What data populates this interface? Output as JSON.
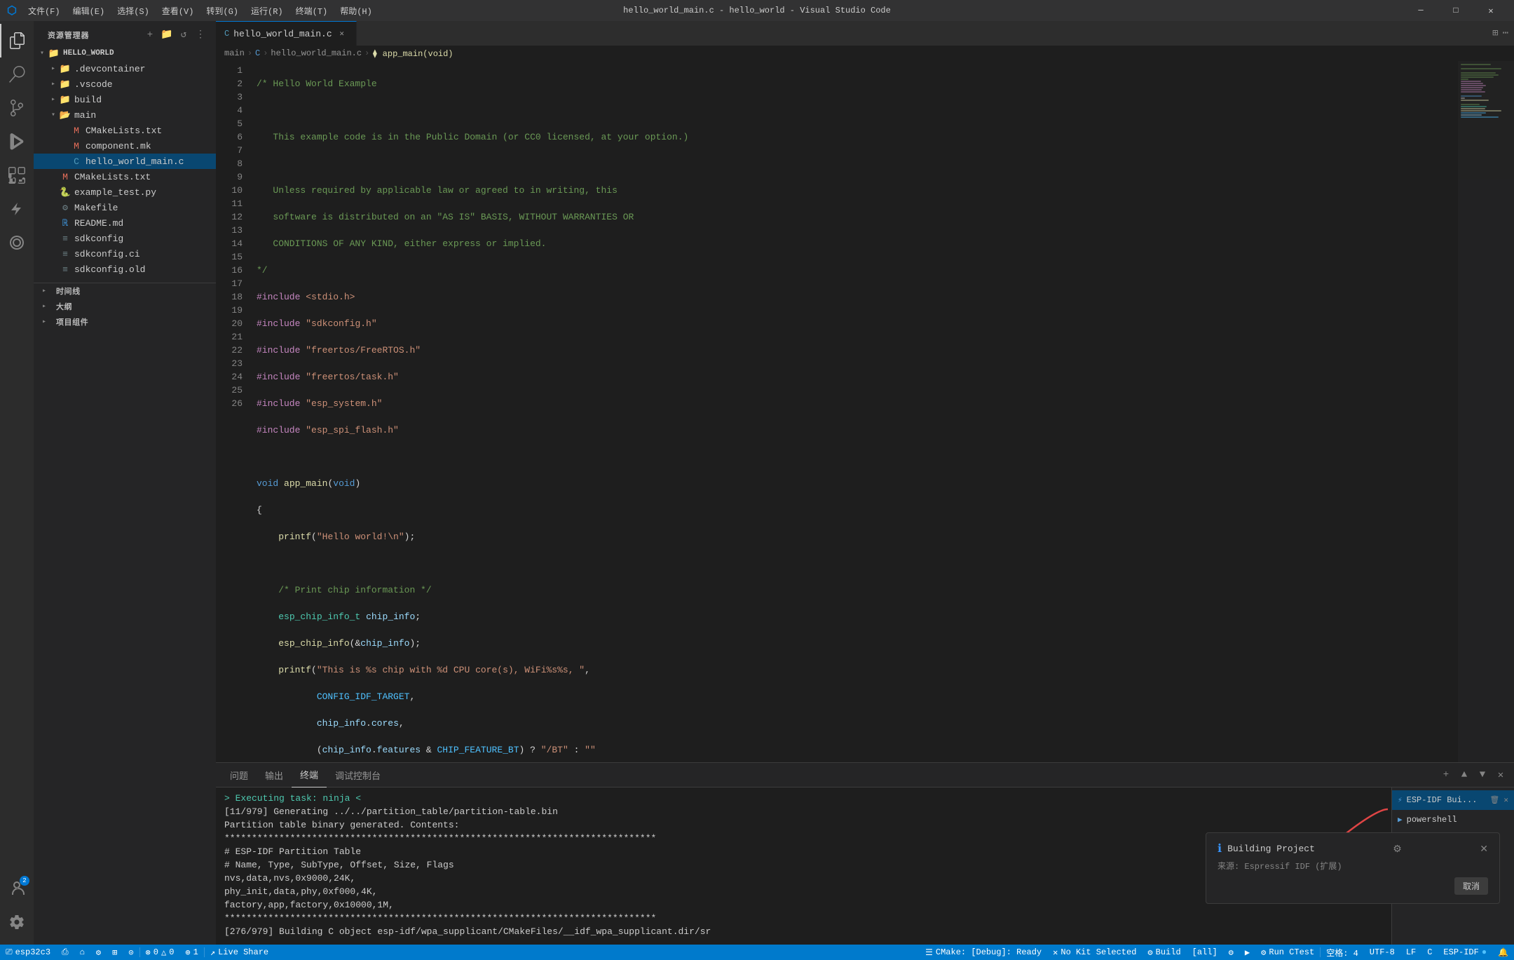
{
  "titleBar": {
    "appIcon": "⬡",
    "menus": [
      "文件(F)",
      "编辑(E)",
      "选择(S)",
      "查看(V)",
      "转到(G)",
      "运行(R)",
      "终端(T)",
      "帮助(H)"
    ],
    "title": "hello_world_main.c - hello_world - Visual Studio Code",
    "windowBtns": [
      "─",
      "□",
      "✕"
    ]
  },
  "activityBar": {
    "items": [
      {
        "icon": "⎘",
        "name": "explorer",
        "label": "资源管理器",
        "active": true
      },
      {
        "icon": "⌕",
        "name": "search",
        "label": "搜索"
      },
      {
        "icon": "⑂",
        "name": "scm",
        "label": "源代码管理"
      },
      {
        "icon": "▶",
        "name": "run",
        "label": "运行和调试"
      },
      {
        "icon": "⧉",
        "name": "extensions",
        "label": "扩展"
      },
      {
        "icon": "⚡",
        "name": "esp-idf",
        "label": "ESP-IDF"
      },
      {
        "icon": "⊙",
        "name": "remote",
        "label": "远程资源管理器"
      }
    ],
    "bottomItems": [
      {
        "icon": "👤",
        "name": "account",
        "label": "账户",
        "badge": "2"
      },
      {
        "icon": "⚙",
        "name": "settings",
        "label": "管理"
      }
    ]
  },
  "sidebar": {
    "title": "资源管理器",
    "sections": [
      {
        "name": "时间线",
        "collapsed": true
      },
      {
        "name": "大纲",
        "collapsed": true
      },
      {
        "name": "项目组件",
        "collapsed": true
      }
    ],
    "root": {
      "name": "HELLO_WORLD",
      "expanded": true,
      "children": [
        {
          "name": ".devcontainer",
          "type": "folder",
          "indent": 1,
          "expanded": false
        },
        {
          "name": ".vscode",
          "type": "folder",
          "indent": 1,
          "expanded": false
        },
        {
          "name": "build",
          "type": "folder",
          "indent": 1,
          "expanded": false
        },
        {
          "name": "main",
          "type": "folder",
          "indent": 1,
          "expanded": true,
          "children": [
            {
              "name": "CMakeLists.txt",
              "type": "cmake",
              "indent": 2
            },
            {
              "name": "component.mk",
              "type": "cmake",
              "indent": 2
            },
            {
              "name": "hello_world_main.c",
              "type": "c",
              "indent": 2,
              "selected": true
            }
          ]
        },
        {
          "name": "CMakeLists.txt",
          "type": "cmake",
          "indent": 1
        },
        {
          "name": "example_test.py",
          "type": "python",
          "indent": 1
        },
        {
          "name": "Makefile",
          "type": "makefile",
          "indent": 1
        },
        {
          "name": "README.md",
          "type": "markdown",
          "indent": 1
        },
        {
          "name": "sdkconfig",
          "type": "text",
          "indent": 1
        },
        {
          "name": "sdkconfig.ci",
          "type": "text",
          "indent": 1
        },
        {
          "name": "sdkconfig.old",
          "type": "text",
          "indent": 1
        }
      ]
    }
  },
  "editor": {
    "tabs": [
      {
        "name": "hello_world_main.c",
        "type": "c",
        "active": true,
        "modified": false
      }
    ],
    "breadcrumb": [
      "main",
      "C",
      "hello_world_main.c",
      "app_main(void)"
    ],
    "lines": [
      {
        "num": 1,
        "code": "/* Hello World Example"
      },
      {
        "num": 2,
        "code": ""
      },
      {
        "num": 3,
        "code": "   This example code is in the Public Domain (or CC0 licensed, at your option.)"
      },
      {
        "num": 4,
        "code": ""
      },
      {
        "num": 5,
        "code": "   Unless required by applicable law or agreed to in writing, this"
      },
      {
        "num": 6,
        "code": "   software is distributed on an \"AS IS\" BASIS, WITHOUT WARRANTIES OR"
      },
      {
        "num": 7,
        "code": "   CONDITIONS OF ANY KIND, either express or implied."
      },
      {
        "num": 8,
        "code": "*/"
      },
      {
        "num": 9,
        "code": "#include <stdio.h>"
      },
      {
        "num": 10,
        "code": "#include \"sdkconfig.h\""
      },
      {
        "num": 11,
        "code": "#include \"freertos/FreeRTOS.h\""
      },
      {
        "num": 12,
        "code": "#include \"freertos/task.h\""
      },
      {
        "num": 13,
        "code": "#include \"esp_system.h\""
      },
      {
        "num": 14,
        "code": "#include \"esp_spi_flash.h\""
      },
      {
        "num": 15,
        "code": ""
      },
      {
        "num": 16,
        "code": "void app_main(void)"
      },
      {
        "num": 17,
        "code": "{"
      },
      {
        "num": 18,
        "code": "    printf(\"Hello world!\\n\");"
      },
      {
        "num": 19,
        "code": ""
      },
      {
        "num": 20,
        "code": "    /* Print chip information */"
      },
      {
        "num": 21,
        "code": "    esp_chip_info_t chip_info;"
      },
      {
        "num": 22,
        "code": "    esp_chip_info(&chip_info);"
      },
      {
        "num": 23,
        "code": "    printf(\"This is %s chip with %d CPU core(s), WiFi%s%s, \","
      },
      {
        "num": 24,
        "code": "           CONFIG_IDF_TARGET,"
      },
      {
        "num": 25,
        "code": "           chip_info.cores,"
      },
      {
        "num": 26,
        "code": "           (chip_info.features & CHIP_FEATURE_BT) ? \"/BT\" : \"\""
      }
    ]
  },
  "panel": {
    "tabs": [
      "问题",
      "输出",
      "终端",
      "调试控制台"
    ],
    "activeTab": "终端",
    "terminalItems": [
      {
        "name": "ESP-IDF Bui...",
        "icon": "⚡",
        "active": true
      },
      {
        "name": "powershell",
        "icon": "▶"
      }
    ],
    "content": [
      "> Executing task: ninja <",
      "",
      "[11/979] Generating ../../partition_table/partition-table.bin",
      "Partition table binary generated. Contents:",
      "*******************************************************************************",
      "# ESP-IDF Partition Table",
      "# Name, Type, SubType, Offset, Size, Flags",
      "nvs,data,nvs,0x9000,24K,",
      "phy_init,data,phy,0xf000,4K,",
      "factory,app,factory,0x10000,1M,",
      "*******************************************************************************",
      "",
      "[276/979] Building C object esp-idf/wpa_supplicant/CMakeFiles/__idf_wpa_supplicant.dir/sr"
    ]
  },
  "notification": {
    "icon": "ℹ",
    "title": "Building Project",
    "source": "来源: Espressif IDF (扩展)",
    "settingsIcon": "⚙",
    "cancelBtn": "取消"
  },
  "statusBar": {
    "items": [
      {
        "text": "⎚ esp32c3",
        "name": "esp32c3"
      },
      {
        "text": "⎙",
        "name": "flash-icon"
      },
      {
        "text": "⌂",
        "name": "monitor-icon"
      },
      {
        "text": "⚙",
        "name": "config-icon"
      },
      {
        "text": "⊞",
        "name": "build-config"
      },
      {
        "text": "⚐",
        "name": "flag"
      },
      {
        "text": "⊙",
        "name": "device"
      },
      {
        "text": "⚠ 0 △ 0",
        "name": "problems"
      },
      {
        "text": "⊕ 1",
        "name": "ports"
      },
      {
        "text": "$(live-share) Live Share",
        "name": "live-share"
      },
      {
        "text": "CMake: [Debug]: Ready",
        "name": "cmake-status"
      },
      {
        "text": "✕ No Kit Selected",
        "name": "cmake-kit"
      },
      {
        "text": "⚙ Build",
        "name": "cmake-build"
      },
      {
        "text": "[all]",
        "name": "cmake-target"
      },
      {
        "text": "⚙",
        "name": "settings2"
      },
      {
        "text": "▶",
        "name": "run-btn"
      },
      {
        "text": "⚙ Run CTest",
        "name": "ctest"
      },
      {
        "text": "空格: 4",
        "name": "indent"
      },
      {
        "text": "UTF-8",
        "name": "encoding"
      },
      {
        "text": "LF",
        "name": "eol"
      },
      {
        "text": "C",
        "name": "language"
      },
      {
        "text": "ESP-IDF ●",
        "name": "esp-idf-status"
      },
      {
        "text": "🔔",
        "name": "notification-bell"
      }
    ]
  }
}
